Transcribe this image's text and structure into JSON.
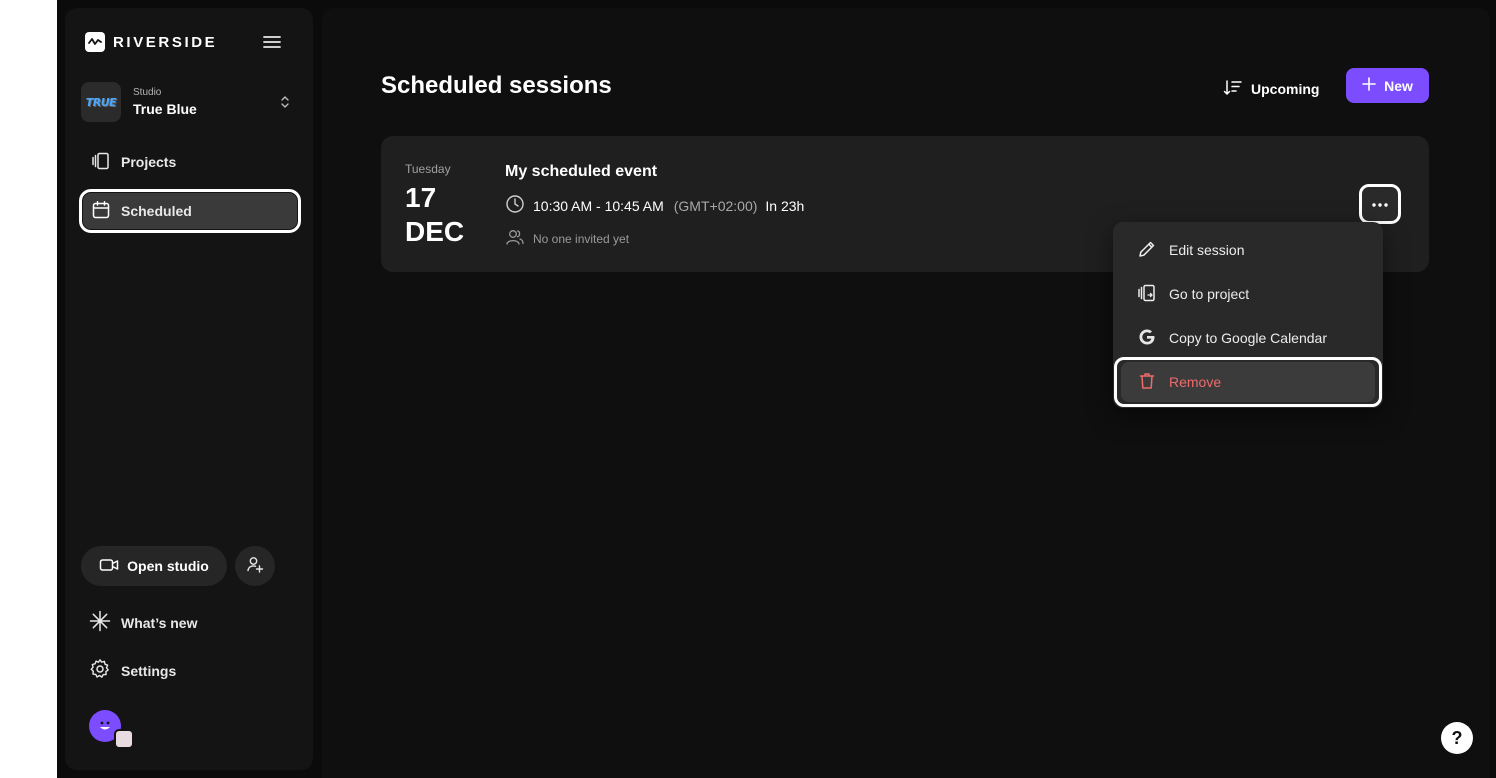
{
  "brand": {
    "name": "RIVERSIDE",
    "accent": "#7b4dff",
    "danger": "#ef6b6b"
  },
  "studio": {
    "caption": "Studio",
    "name": "True Blue",
    "avatar_text": "TRUE"
  },
  "sidebar": {
    "items": [
      {
        "label": "Projects",
        "icon": "projects-icon"
      },
      {
        "label": "Scheduled",
        "icon": "calendar-icon",
        "active": true
      }
    ],
    "open_studio_label": "Open studio",
    "whats_new_label": "What’s new",
    "settings_label": "Settings"
  },
  "main": {
    "title": "Scheduled sessions",
    "sort_label": "Upcoming",
    "new_label": "New"
  },
  "session": {
    "day_name": "Tuesday",
    "day": "17",
    "month": "DEC",
    "title": "My scheduled event",
    "time": "10:30 AM - 10:45 AM",
    "timezone": "(GMT+02:00)",
    "relative": "In 23h",
    "invited": "No one invited yet"
  },
  "menu": {
    "items": [
      {
        "label": "Edit session",
        "icon": "pencil-icon"
      },
      {
        "label": "Go to project",
        "icon": "go-to-project-icon"
      },
      {
        "label": "Copy to Google Calendar",
        "icon": "google-icon"
      },
      {
        "label": "Remove",
        "icon": "trash-icon",
        "danger": true
      }
    ]
  },
  "help_label": "?"
}
